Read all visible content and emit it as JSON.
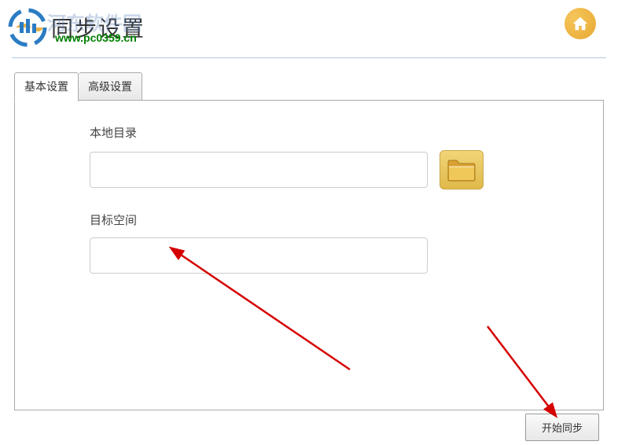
{
  "header": {
    "title": "同步设置",
    "watermark_text": "河东软件园",
    "watermark_url": "www.pc0359.cn"
  },
  "tabs": {
    "basic": "基本设置",
    "advanced": "高级设置"
  },
  "form": {
    "local_dir_label": "本地目录",
    "local_dir_value": "",
    "target_space_label": "目标空间",
    "target_space_value": ""
  },
  "buttons": {
    "start_sync": "开始同步"
  }
}
